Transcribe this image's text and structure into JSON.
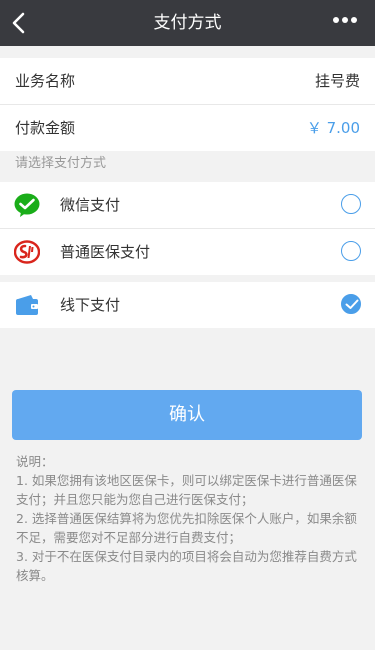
{
  "nav": {
    "title": "支付方式"
  },
  "info": {
    "service_label": "业务名称",
    "service_value": "挂号费",
    "amount_label": "付款金额",
    "amount_value": "￥ 7.00"
  },
  "section_title": "请选择支付方式",
  "payment_methods": [
    {
      "label": "微信支付",
      "icon": "wechat-pay-icon",
      "selected": false
    },
    {
      "label": "普通医保支付",
      "icon": "medical-insurance-icon",
      "selected": false
    },
    {
      "label": "线下支付",
      "icon": "wallet-icon",
      "selected": true
    }
  ],
  "confirm_label": "确认",
  "notes": {
    "heading": "说明：",
    "items": [
      "1. 如果您拥有该地区医保卡，则可以绑定医保卡进行普通医保支付；并且您只能为您自己进行医保支付；",
      "2. 选择普通医保结算将为您优先扣除医保个人账户，如果余额不足，需要您对不足部分进行自费支付；",
      "3. 对于不在医保支付目录内的项目将会自动为您推荐自费方式核算。"
    ]
  },
  "colors": {
    "nav_bg": "#393a3f",
    "accent": "#4a9ee9",
    "button": "#62a9f0",
    "wechat": "#1aad19",
    "insurance": "#d9251c"
  }
}
